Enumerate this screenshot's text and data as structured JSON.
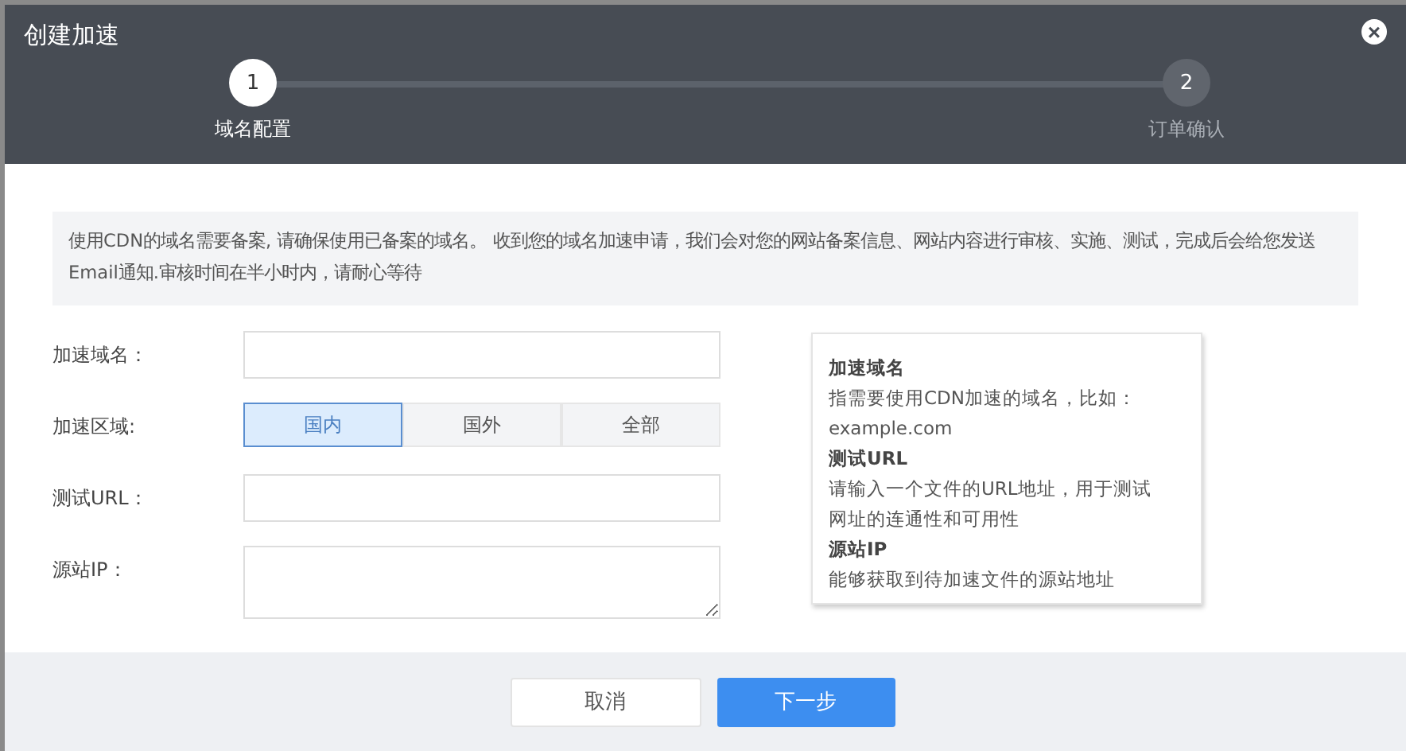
{
  "dialog": {
    "title": "创建加速",
    "close_icon": "×"
  },
  "steps": [
    {
      "number": "1",
      "label": "域名配置",
      "selected": true
    },
    {
      "number": "2",
      "label": "订单确认",
      "selected": false
    }
  ],
  "notice": "使用CDN的域名需要备案, 请确保使用已备案的域名。 收到您的域名加速申请，我们会对您的网站备案信息、网站内容进行审核、实施、测试，完成后会给您发送 Email通知.审核时间在半小时内，请耐心等待",
  "form": [
    {
      "kind": "input",
      "label": "加速域名："
    },
    {
      "kind": "segmented",
      "label": "加速区域:",
      "options": [
        {
          "label": "国内",
          "selected": true
        },
        {
          "label": "国外",
          "selected": false
        },
        {
          "label": "全部",
          "selected": false
        }
      ]
    },
    {
      "kind": "input",
      "label": "测试URL："
    },
    {
      "kind": "textarea",
      "label": "源站IP："
    }
  ],
  "help": [
    {
      "title": "加速域名",
      "lines": [
        "指需要使用CDN加速的域名，比如：",
        "example.com"
      ]
    },
    {
      "title": "测试URL",
      "lines": [
        "请输入一个文件的URL地址，用于测试",
        "网址的连通性和可用性"
      ]
    },
    {
      "title": "源站IP",
      "lines": [
        "能够获取到待加速文件的源站地址"
      ]
    }
  ],
  "buttons": [
    {
      "label": "取消",
      "kind": "secondary"
    },
    {
      "label": "下一步",
      "kind": "primary"
    }
  ]
}
